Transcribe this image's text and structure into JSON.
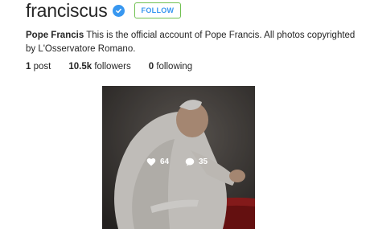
{
  "profile": {
    "username": "franciscus",
    "follow_label": "FOLLOW",
    "full_name": "Pope Francis",
    "bio": "This is the official account of Pope Francis. All photos copyrighted by L'Osservatore Romano."
  },
  "stats": {
    "posts_count": "1",
    "posts_label": "post",
    "followers_count": "10.5k",
    "followers_label": "followers",
    "following_count": "0",
    "following_label": "following"
  },
  "post": {
    "likes": "64",
    "comments": "35"
  },
  "colors": {
    "verified": "#3897f0",
    "follow_border": "#70c050",
    "follow_text": "#3897f0"
  }
}
